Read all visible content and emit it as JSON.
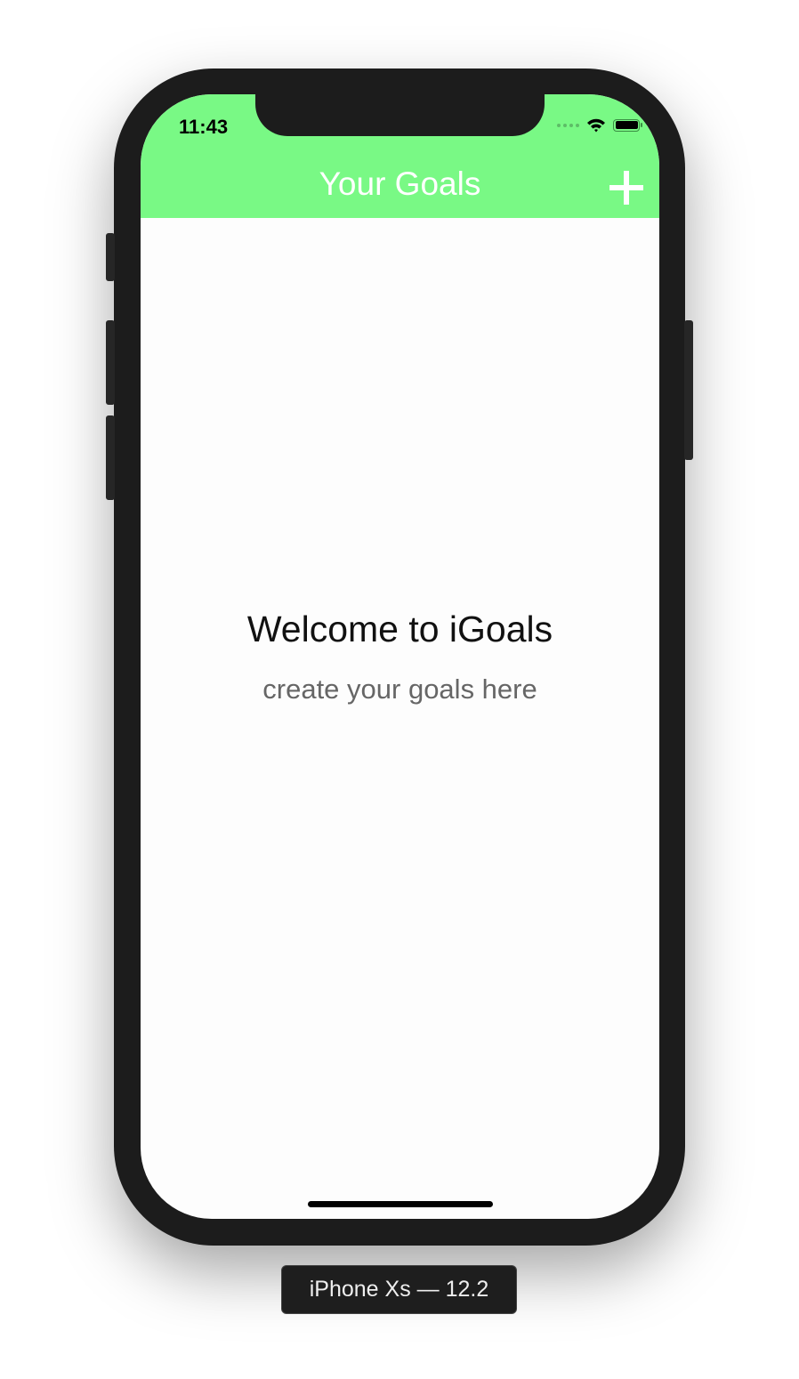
{
  "status_bar": {
    "time": "11:43",
    "icons": [
      "signal-dots-icon",
      "wifi-icon",
      "battery-icon"
    ]
  },
  "navbar": {
    "title": "Your Goals",
    "add_icon": "plus-icon",
    "color": "#79f985"
  },
  "main": {
    "welcome": "Welcome to iGoals",
    "subtitle": "create your goals here"
  },
  "device_label": "iPhone Xs — 12.2"
}
